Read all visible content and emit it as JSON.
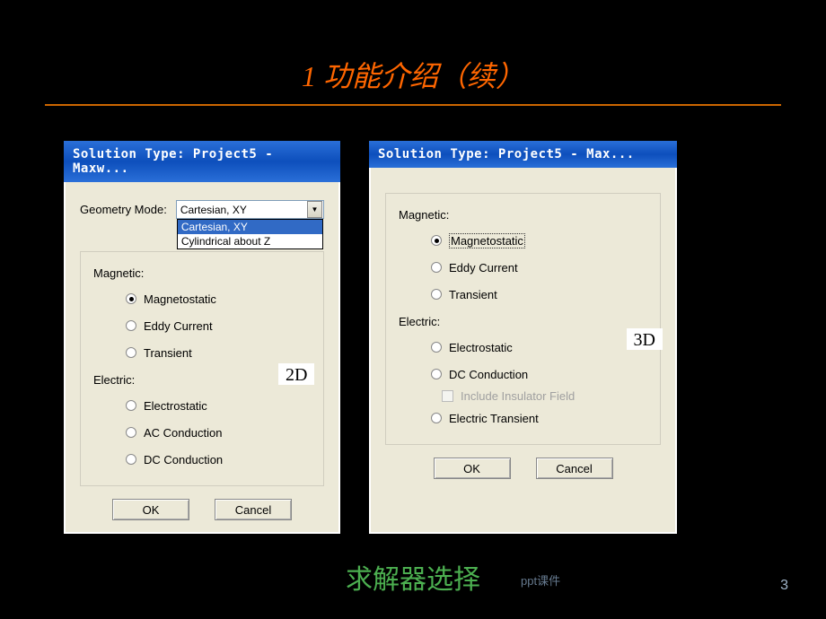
{
  "slide": {
    "title": "1 功能介绍（续）",
    "caption": "求解器选择",
    "footer_note": "ppt课件",
    "page_number": "3"
  },
  "dialog2d": {
    "title": "Solution Type: Project5 - Maxw...",
    "geometry_label": "Geometry Mode:",
    "combo_value": "Cartesian, XY",
    "combo_options": [
      "Cartesian, XY",
      "Cylindrical about Z"
    ],
    "magnetic_label": "Magnetic:",
    "magnetic_options": [
      "Magnetostatic",
      "Eddy Current",
      "Transient"
    ],
    "electric_label": "Electric:",
    "electric_options": [
      "Electrostatic",
      "AC Conduction",
      "DC Conduction"
    ],
    "ok": "OK",
    "cancel": "Cancel",
    "patch": "2D"
  },
  "dialog3d": {
    "title": "Solution Type: Project5 - Max...",
    "magnetic_label": "Magnetic:",
    "magnetic_options": [
      "Magnetostatic",
      "Eddy Current",
      "Transient"
    ],
    "electric_label": "Electric:",
    "electric_options": [
      "Electrostatic",
      "DC Conduction",
      "Electric Transient"
    ],
    "include_insulator": "Include Insulator Field",
    "ok": "OK",
    "cancel": "Cancel",
    "patch": "3D"
  }
}
